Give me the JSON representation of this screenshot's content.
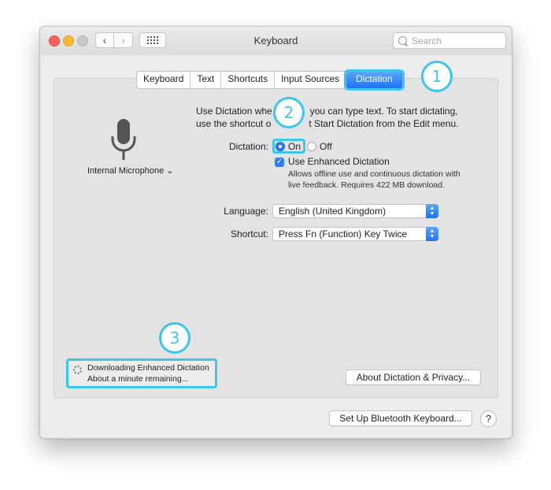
{
  "window": {
    "title": "Keyboard",
    "search_placeholder": "Search"
  },
  "tabs": [
    "Keyboard",
    "Text",
    "Shortcuts",
    "Input Sources",
    "Dictation"
  ],
  "active_tab": "Dictation",
  "callouts": [
    "1",
    "2",
    "3"
  ],
  "mic": {
    "label": "Internal Microphone ⌄",
    "icon": "microphone-icon"
  },
  "description": {
    "line1": "Use Dictation whe    you can type text. To start dictating,",
    "line2": "use the shortcut o    t Start Dictation from the Edit menu."
  },
  "dictation": {
    "label": "Dictation:",
    "on": "On",
    "off": "Off",
    "enhanced_label": "Use Enhanced Dictation",
    "enhanced_desc_1": "Allows offline use and continuous dictation with",
    "enhanced_desc_2": "live feedback. Requires 422 MB download."
  },
  "language": {
    "label": "Language:",
    "value": "English (United Kingdom)"
  },
  "shortcut": {
    "label": "Shortcut:",
    "value": "Press Fn (Function) Key Twice"
  },
  "download": {
    "line1": "Downloading Enhanced Dictation",
    "line2": "About a minute remaining..."
  },
  "buttons": {
    "about": "About Dictation & Privacy...",
    "bluetooth": "Set Up Bluetooth Keyboard...",
    "help": "?"
  },
  "colors": {
    "accent": "#1d72f2",
    "callout": "#3cc6ea"
  }
}
